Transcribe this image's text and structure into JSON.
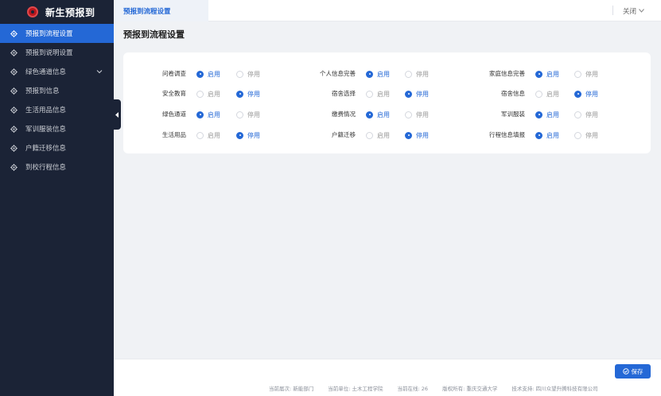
{
  "app": {
    "title": "新生预报到"
  },
  "sidebar": {
    "items": [
      {
        "label": "预报到流程设置",
        "active": true,
        "has_children": false
      },
      {
        "label": "预报到说明设置",
        "active": false,
        "has_children": false
      },
      {
        "label": "绿色通道信息",
        "active": false,
        "has_children": true
      },
      {
        "label": "预报到信息",
        "active": false,
        "has_children": false
      },
      {
        "label": "生活用品信息",
        "active": false,
        "has_children": false
      },
      {
        "label": "军训服装信息",
        "active": false,
        "has_children": false
      },
      {
        "label": "户籍迁移信息",
        "active": false,
        "has_children": false
      },
      {
        "label": "到校行程信息",
        "active": false,
        "has_children": false
      }
    ]
  },
  "topbar": {
    "tab_label": "预报到流程设置",
    "close_label": "关闭"
  },
  "main": {
    "title": "预报到流程设置",
    "option_on": "启用",
    "option_off": "停用",
    "settings": [
      {
        "label": "问卷调查",
        "enabled": true
      },
      {
        "label": "个人信息完善",
        "enabled": true
      },
      {
        "label": "家庭信息完善",
        "enabled": true
      },
      {
        "label": "安全教育",
        "enabled": false
      },
      {
        "label": "宿舍选择",
        "enabled": false
      },
      {
        "label": "宿舍信息",
        "enabled": false
      },
      {
        "label": "绿色通道",
        "enabled": true
      },
      {
        "label": "缴费情况",
        "enabled": true
      },
      {
        "label": "军训服装",
        "enabled": true
      },
      {
        "label": "生活用品",
        "enabled": false
      },
      {
        "label": "户籍迁移",
        "enabled": false
      },
      {
        "label": "行程信息填报",
        "enabled": true
      }
    ]
  },
  "actions": {
    "save_label": "保存"
  },
  "footer": {
    "items": [
      "当前届次: 新能部门",
      "当前单位: 土木工程学院",
      "当前在线: 26",
      "版权所有: 重庆交通大学",
      "技术支持: 四川众望升腾科技有限公司"
    ]
  },
  "colors": {
    "accent": "#2468d6",
    "sidebar_bg": "#1b2336",
    "page_bg": "#f0f2f5"
  }
}
